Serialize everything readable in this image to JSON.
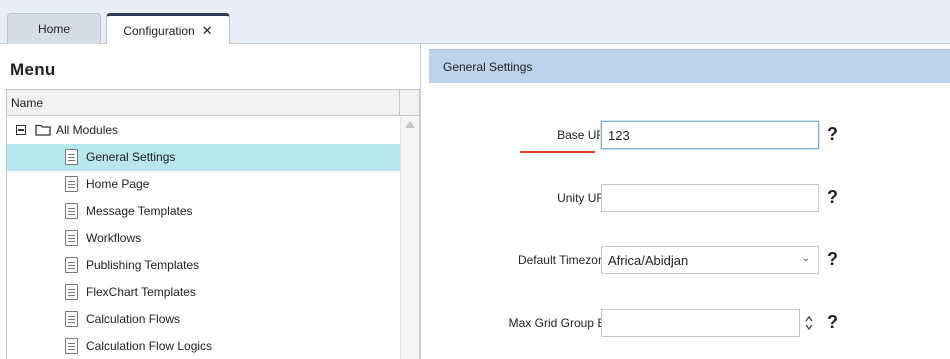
{
  "tabs": [
    {
      "label": "Home",
      "active": false
    },
    {
      "label": "Configuration",
      "active": true,
      "close_glyph": "✕"
    }
  ],
  "menu": {
    "title": "Menu",
    "column_header": "Name",
    "tree": {
      "root_label": "All Modules",
      "items": [
        {
          "label": "General Settings",
          "selected": true
        },
        {
          "label": "Home Page",
          "selected": false
        },
        {
          "label": "Message Templates",
          "selected": false
        },
        {
          "label": "Workflows",
          "selected": false
        },
        {
          "label": "Publishing Templates",
          "selected": false
        },
        {
          "label": "FlexChart Templates",
          "selected": false
        },
        {
          "label": "Calculation Flows",
          "selected": false
        },
        {
          "label": "Calculation Flow Logics",
          "selected": false
        }
      ]
    }
  },
  "settings": {
    "header": "General Settings",
    "help_glyph": "?",
    "fields": {
      "base_url": {
        "label": "Base URL :",
        "value": "123"
      },
      "unity_url": {
        "label": "Unity URL :",
        "value": ""
      },
      "default_timezone": {
        "label": "Default Timezone :",
        "value": "Africa/Abidjan"
      },
      "max_grid_group_by": {
        "label": "Max Grid Group By :",
        "value": ""
      }
    }
  },
  "colors": {
    "accent_underline": "#e0451f",
    "selected_row": "#b7e6ec",
    "panel_header": "#bcd3ea",
    "active_tab_top": "#2f3a52"
  }
}
